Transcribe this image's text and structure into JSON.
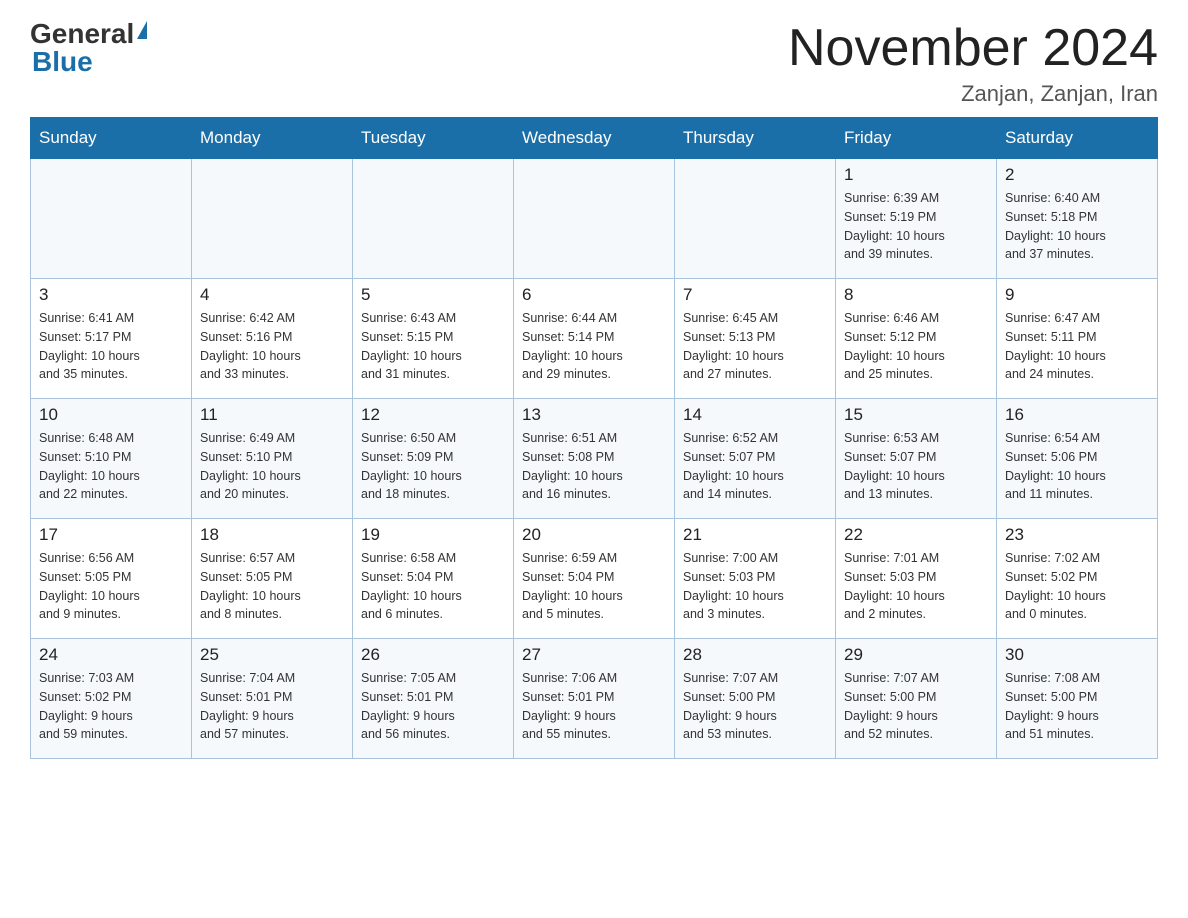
{
  "logo": {
    "general": "General",
    "blue": "Blue"
  },
  "title": "November 2024",
  "subtitle": "Zanjan, Zanjan, Iran",
  "weekdays": [
    "Sunday",
    "Monday",
    "Tuesday",
    "Wednesday",
    "Thursday",
    "Friday",
    "Saturday"
  ],
  "weeks": [
    [
      {
        "day": "",
        "info": ""
      },
      {
        "day": "",
        "info": ""
      },
      {
        "day": "",
        "info": ""
      },
      {
        "day": "",
        "info": ""
      },
      {
        "day": "",
        "info": ""
      },
      {
        "day": "1",
        "info": "Sunrise: 6:39 AM\nSunset: 5:19 PM\nDaylight: 10 hours\nand 39 minutes."
      },
      {
        "day": "2",
        "info": "Sunrise: 6:40 AM\nSunset: 5:18 PM\nDaylight: 10 hours\nand 37 minutes."
      }
    ],
    [
      {
        "day": "3",
        "info": "Sunrise: 6:41 AM\nSunset: 5:17 PM\nDaylight: 10 hours\nand 35 minutes."
      },
      {
        "day": "4",
        "info": "Sunrise: 6:42 AM\nSunset: 5:16 PM\nDaylight: 10 hours\nand 33 minutes."
      },
      {
        "day": "5",
        "info": "Sunrise: 6:43 AM\nSunset: 5:15 PM\nDaylight: 10 hours\nand 31 minutes."
      },
      {
        "day": "6",
        "info": "Sunrise: 6:44 AM\nSunset: 5:14 PM\nDaylight: 10 hours\nand 29 minutes."
      },
      {
        "day": "7",
        "info": "Sunrise: 6:45 AM\nSunset: 5:13 PM\nDaylight: 10 hours\nand 27 minutes."
      },
      {
        "day": "8",
        "info": "Sunrise: 6:46 AM\nSunset: 5:12 PM\nDaylight: 10 hours\nand 25 minutes."
      },
      {
        "day": "9",
        "info": "Sunrise: 6:47 AM\nSunset: 5:11 PM\nDaylight: 10 hours\nand 24 minutes."
      }
    ],
    [
      {
        "day": "10",
        "info": "Sunrise: 6:48 AM\nSunset: 5:10 PM\nDaylight: 10 hours\nand 22 minutes."
      },
      {
        "day": "11",
        "info": "Sunrise: 6:49 AM\nSunset: 5:10 PM\nDaylight: 10 hours\nand 20 minutes."
      },
      {
        "day": "12",
        "info": "Sunrise: 6:50 AM\nSunset: 5:09 PM\nDaylight: 10 hours\nand 18 minutes."
      },
      {
        "day": "13",
        "info": "Sunrise: 6:51 AM\nSunset: 5:08 PM\nDaylight: 10 hours\nand 16 minutes."
      },
      {
        "day": "14",
        "info": "Sunrise: 6:52 AM\nSunset: 5:07 PM\nDaylight: 10 hours\nand 14 minutes."
      },
      {
        "day": "15",
        "info": "Sunrise: 6:53 AM\nSunset: 5:07 PM\nDaylight: 10 hours\nand 13 minutes."
      },
      {
        "day": "16",
        "info": "Sunrise: 6:54 AM\nSunset: 5:06 PM\nDaylight: 10 hours\nand 11 minutes."
      }
    ],
    [
      {
        "day": "17",
        "info": "Sunrise: 6:56 AM\nSunset: 5:05 PM\nDaylight: 10 hours\nand 9 minutes."
      },
      {
        "day": "18",
        "info": "Sunrise: 6:57 AM\nSunset: 5:05 PM\nDaylight: 10 hours\nand 8 minutes."
      },
      {
        "day": "19",
        "info": "Sunrise: 6:58 AM\nSunset: 5:04 PM\nDaylight: 10 hours\nand 6 minutes."
      },
      {
        "day": "20",
        "info": "Sunrise: 6:59 AM\nSunset: 5:04 PM\nDaylight: 10 hours\nand 5 minutes."
      },
      {
        "day": "21",
        "info": "Sunrise: 7:00 AM\nSunset: 5:03 PM\nDaylight: 10 hours\nand 3 minutes."
      },
      {
        "day": "22",
        "info": "Sunrise: 7:01 AM\nSunset: 5:03 PM\nDaylight: 10 hours\nand 2 minutes."
      },
      {
        "day": "23",
        "info": "Sunrise: 7:02 AM\nSunset: 5:02 PM\nDaylight: 10 hours\nand 0 minutes."
      }
    ],
    [
      {
        "day": "24",
        "info": "Sunrise: 7:03 AM\nSunset: 5:02 PM\nDaylight: 9 hours\nand 59 minutes."
      },
      {
        "day": "25",
        "info": "Sunrise: 7:04 AM\nSunset: 5:01 PM\nDaylight: 9 hours\nand 57 minutes."
      },
      {
        "day": "26",
        "info": "Sunrise: 7:05 AM\nSunset: 5:01 PM\nDaylight: 9 hours\nand 56 minutes."
      },
      {
        "day": "27",
        "info": "Sunrise: 7:06 AM\nSunset: 5:01 PM\nDaylight: 9 hours\nand 55 minutes."
      },
      {
        "day": "28",
        "info": "Sunrise: 7:07 AM\nSunset: 5:00 PM\nDaylight: 9 hours\nand 53 minutes."
      },
      {
        "day": "29",
        "info": "Sunrise: 7:07 AM\nSunset: 5:00 PM\nDaylight: 9 hours\nand 52 minutes."
      },
      {
        "day": "30",
        "info": "Sunrise: 7:08 AM\nSunset: 5:00 PM\nDaylight: 9 hours\nand 51 minutes."
      }
    ]
  ]
}
